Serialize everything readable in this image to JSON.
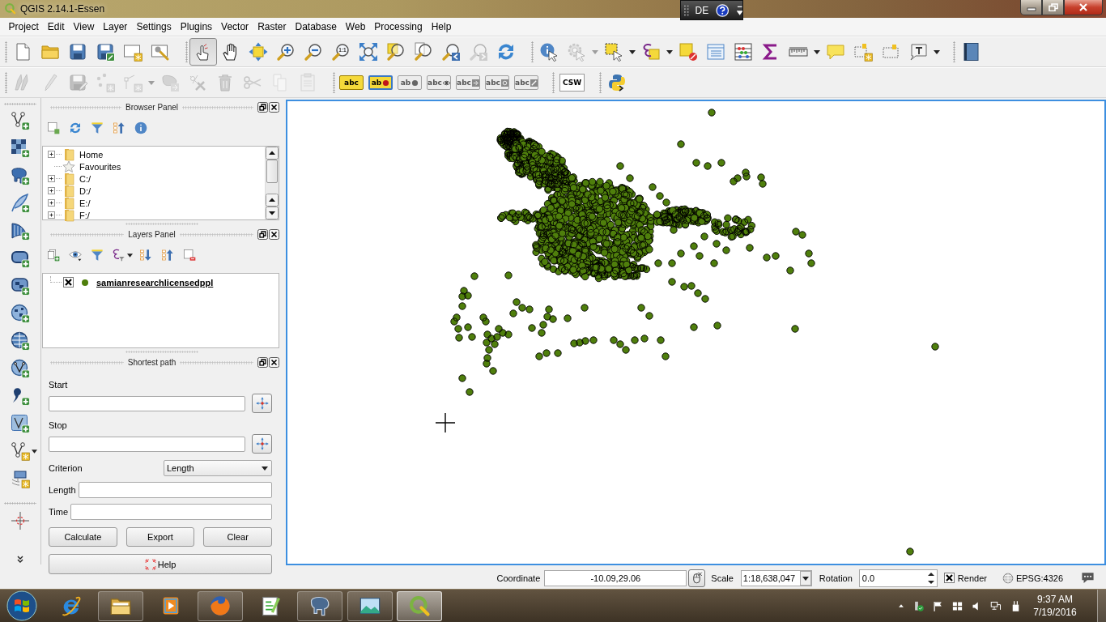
{
  "window": {
    "title": "QGIS 2.14.1-Essen"
  },
  "language_bar": {
    "language": "DE"
  },
  "menu": [
    "Project",
    "Edit",
    "View",
    "Layer",
    "Settings",
    "Plugins",
    "Vector",
    "Raster",
    "Database",
    "Web",
    "Processing",
    "Help"
  ],
  "toolbar_rows": [
    [
      [
        {
          "kind": "new",
          "disabled": false,
          "selected": false
        },
        {
          "kind": "open",
          "disabled": false,
          "selected": false
        },
        {
          "kind": "save",
          "disabled": false,
          "selected": false
        },
        {
          "kind": "saveas",
          "disabled": false,
          "selected": false
        },
        {
          "kind": "composer",
          "disabled": false,
          "selected": false
        },
        {
          "kind": "manager",
          "disabled": false,
          "selected": false
        }
      ],
      [
        {
          "kind": "touch",
          "disabled": false,
          "selected": true
        },
        {
          "kind": "pan",
          "disabled": false,
          "selected": false
        },
        {
          "kind": "pansel",
          "disabled": false,
          "selected": false
        },
        {
          "kind": "zoomin",
          "disabled": false,
          "selected": false
        },
        {
          "kind": "zoomout",
          "disabled": false,
          "selected": false
        },
        {
          "kind": "zoom11",
          "label": "1:1",
          "disabled": false,
          "selected": false
        },
        {
          "kind": "zoomfull",
          "disabled": false,
          "selected": false
        },
        {
          "kind": "zoomsel",
          "disabled": false,
          "selected": false
        },
        {
          "kind": "zoomlayer",
          "disabled": false,
          "selected": false
        },
        {
          "kind": "zoomlast",
          "disabled": false,
          "selected": false
        },
        {
          "kind": "zoomnext",
          "disabled": true,
          "selected": false
        },
        {
          "kind": "refresh",
          "disabled": false,
          "selected": false
        }
      ],
      [
        {
          "kind": "identify",
          "disabled": false,
          "selected": false
        },
        {
          "kind": "action",
          "disabled": true,
          "selected": false
        },
        {
          "kind": "arrow",
          "disabled": true,
          "selected": false
        },
        {
          "kind": "select",
          "disabled": false,
          "selected": false
        },
        {
          "kind": "arrow",
          "disabled": false,
          "selected": false
        },
        {
          "kind": "selexpr",
          "disabled": false,
          "selected": false
        },
        {
          "kind": "arrow",
          "disabled": false,
          "selected": false
        },
        {
          "kind": "deselect",
          "disabled": false,
          "selected": false
        },
        {
          "kind": "table",
          "disabled": false,
          "selected": false
        },
        {
          "kind": "stats",
          "disabled": false,
          "selected": false
        },
        {
          "kind": "sum",
          "disabled": false,
          "selected": false
        },
        {
          "kind": "measure",
          "disabled": false,
          "selected": false
        },
        {
          "kind": "arrow",
          "disabled": false,
          "selected": false
        },
        {
          "kind": "maptips",
          "disabled": false,
          "selected": false
        },
        {
          "kind": "newbookmark",
          "disabled": false,
          "selected": false
        },
        {
          "kind": "bookmarks",
          "disabled": false,
          "selected": false
        },
        {
          "kind": "annotation",
          "disabled": false,
          "selected": false
        },
        {
          "kind": "arrow",
          "disabled": false,
          "selected": false
        }
      ],
      [
        {
          "kind": "help",
          "disabled": false,
          "selected": false
        }
      ]
    ],
    [
      [
        {
          "kind": "digitize",
          "disabled": true,
          "selected": false
        },
        {
          "kind": "edit",
          "disabled": true,
          "selected": false
        },
        {
          "kind": "saveedits",
          "disabled": true,
          "selected": false
        },
        {
          "kind": "addpoint",
          "disabled": true,
          "selected": false
        },
        {
          "kind": "node",
          "disabled": true,
          "selected": false
        },
        {
          "kind": "arrow",
          "disabled": true,
          "selected": false
        },
        {
          "kind": "shape",
          "disabled": true,
          "selected": false
        },
        {
          "kind": "vertex",
          "disabled": true,
          "selected": false
        },
        {
          "kind": "delete",
          "disabled": true,
          "selected": false
        },
        {
          "kind": "cut",
          "disabled": true,
          "selected": false
        },
        {
          "kind": "copy",
          "disabled": true,
          "selected": false
        },
        {
          "kind": "paste",
          "disabled": true,
          "selected": false
        }
      ],
      [
        {
          "kind": "label",
          "label": "abc",
          "disabled": false,
          "selected": false
        },
        {
          "kind": "labelpin",
          "label": "ab",
          "disabled": false,
          "selected": true
        },
        {
          "kind": "labelpinmove",
          "label": "ab",
          "disabled": true,
          "selected": false
        },
        {
          "kind": "labelshow",
          "label": "abc",
          "disabled": true,
          "selected": false
        },
        {
          "kind": "labelmove",
          "label": "abc",
          "disabled": true,
          "selected": false
        },
        {
          "kind": "labelrotate",
          "label": "abc",
          "disabled": true,
          "selected": false
        },
        {
          "kind": "labelchange",
          "label": "abc",
          "disabled": true,
          "selected": false
        }
      ],
      [
        {
          "kind": "csw",
          "label": "CSW",
          "disabled": false,
          "selected": false
        }
      ],
      [
        {
          "kind": "python",
          "disabled": false,
          "selected": false
        }
      ]
    ]
  ],
  "browser_panel": {
    "title": "Browser Panel",
    "items": [
      {
        "kind": "folder",
        "label": "Home",
        "expanded": false
      },
      {
        "kind": "favourites",
        "label": "Favourites"
      },
      {
        "kind": "folder",
        "label": "C:/",
        "expanded": false
      },
      {
        "kind": "folder",
        "label": "D:/",
        "expanded": false
      },
      {
        "kind": "folder",
        "label": "E:/",
        "expanded": false
      },
      {
        "kind": "folder",
        "label": "F:/",
        "expanded": false
      }
    ]
  },
  "layers_panel": {
    "title": "Layers Panel",
    "layers": [
      {
        "name": "samianresearchlicensedppl",
        "checked": true,
        "color": "#4f7f0c"
      }
    ]
  },
  "shortest_path": {
    "title": "Shortest path",
    "start_label": "Start",
    "stop_label": "Stop",
    "criterion_label": "Criterion",
    "criterion": "Length",
    "length_label": "Length",
    "time_label": "Time",
    "buttons": [
      "Calculate",
      "Export",
      "Clear"
    ],
    "help": "Help"
  },
  "status_bar": {
    "coordinate_label": "Coordinate",
    "coordinate": "-10.09,29.06",
    "scale_label": "Scale",
    "scale": "1:18,638,047",
    "rotation_label": "Rotation",
    "rotation": "0.0",
    "render_label": "Render",
    "render_checked": true,
    "crs": "EPSG:4326"
  },
  "taskbar": {
    "items": [
      {
        "kind": "ie",
        "running": false,
        "selected": false
      },
      {
        "kind": "explorer",
        "running": true,
        "selected": false
      },
      {
        "kind": "player",
        "running": false,
        "selected": false
      },
      {
        "kind": "firefox",
        "running": true,
        "selected": false
      },
      {
        "kind": "notepad",
        "running": false,
        "selected": false
      },
      {
        "kind": "elephant",
        "running": true,
        "selected": false
      },
      {
        "kind": "viewer",
        "running": true,
        "selected": false
      },
      {
        "kind": "qgis",
        "running": true,
        "selected": true
      }
    ],
    "time": "9:37 AM",
    "date": "7/19/2016"
  }
}
